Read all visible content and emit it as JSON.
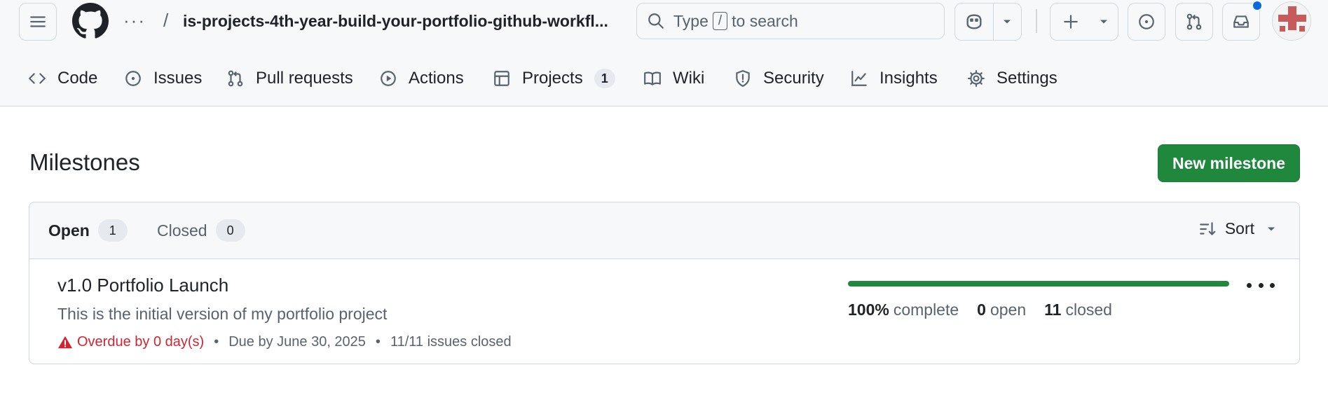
{
  "header": {
    "repo_name": "is-projects-4th-year-build-your-portfolio-github-workfl...",
    "search": {
      "prefix": "Type",
      "key": "/",
      "suffix": "to search"
    }
  },
  "tabs": [
    {
      "label": "Code",
      "icon": "code-icon"
    },
    {
      "label": "Issues",
      "icon": "issue-icon"
    },
    {
      "label": "Pull requests",
      "icon": "pull-request-icon"
    },
    {
      "label": "Actions",
      "icon": "play-icon"
    },
    {
      "label": "Projects",
      "icon": "table-icon",
      "count": "1"
    },
    {
      "label": "Wiki",
      "icon": "book-icon"
    },
    {
      "label": "Security",
      "icon": "shield-icon"
    },
    {
      "label": "Insights",
      "icon": "graph-icon"
    },
    {
      "label": "Settings",
      "icon": "gear-icon"
    }
  ],
  "page": {
    "title": "Milestones",
    "new_button": "New milestone"
  },
  "filters": {
    "open_label": "Open",
    "open_count": "1",
    "closed_label": "Closed",
    "closed_count": "0",
    "sort_label": "Sort"
  },
  "milestone": {
    "title": "v1.0 Portfolio Launch",
    "description": "This is the initial version of my portfolio project",
    "overdue": "Overdue by 0 day(s)",
    "due": "Due by June 30, 2025",
    "issues_closed": "11/11 issues closed",
    "progress_fraction": 1.0,
    "percent": "100%",
    "percent_label": "complete",
    "open_count": "0",
    "open_label": "open",
    "closed_count": "11",
    "closed_label": "closed"
  },
  "colors": {
    "accent_green": "#1f883d",
    "danger_red": "#d1242f",
    "notification_blue": "#0969da"
  }
}
